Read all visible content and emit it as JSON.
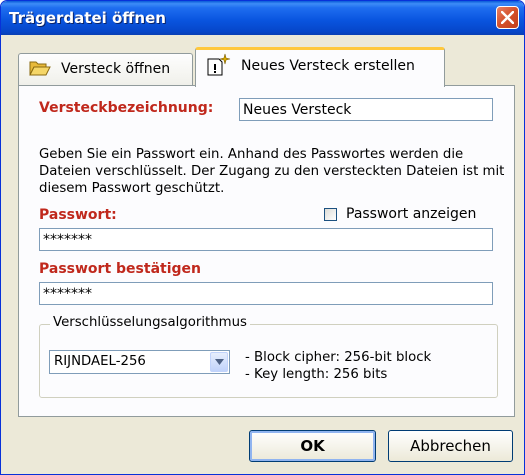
{
  "window": {
    "title": "Trägerdatei öffnen",
    "close_label": "×"
  },
  "tabs": [
    {
      "label": "Versteck öffnen",
      "icon": "folder-open-icon"
    },
    {
      "label": "Neues Versteck erstellen",
      "icon": "new-document-icon"
    }
  ],
  "form": {
    "name_label": "Versteckbezeichnung:",
    "name_value": "Neues Versteck",
    "description": "Geben Sie ein Passwort ein. Anhand des Passwortes werden die Dateien verschlüsselt. Der Zugang zu den versteckten Dateien ist mit diesem Passwort geschützt.",
    "password_label": "Passwort:",
    "password_value": "*******",
    "show_password_label": "Passwort anzeigen",
    "show_password_checked": false,
    "confirm_label": "Passwort bestätigen",
    "confirm_value": "*******"
  },
  "encryption": {
    "group_title": "Verschlüsselungsalgorithmus",
    "algorithm": "RIJNDAEL-256",
    "info": [
      "- Block cipher: 256-bit block",
      "- Key length: 256 bits"
    ]
  },
  "buttons": {
    "ok": "OK",
    "cancel": "Abbrechen"
  },
  "colors": {
    "title_bar": "#0a55e0",
    "label_red": "#c0281c",
    "dialog_bg": "#ece9d8",
    "close_red": "#d4502a",
    "tab_highlight": "#ffc83c"
  }
}
